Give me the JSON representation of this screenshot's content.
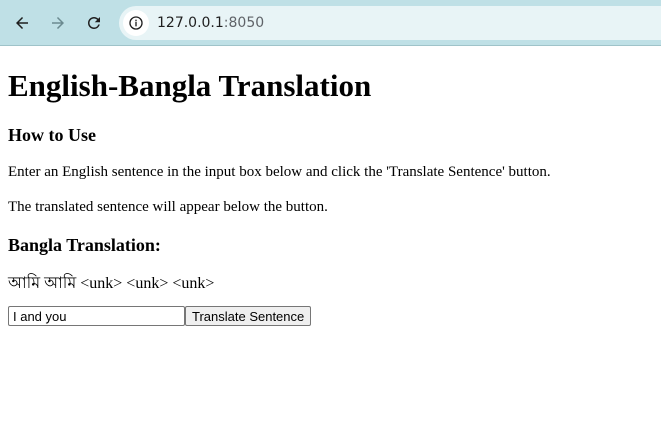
{
  "browser": {
    "url_host": "127.0.0.1",
    "url_port": ":8050",
    "icons": [
      "back-arrow-icon",
      "forward-arrow-icon",
      "reload-icon",
      "info-icon"
    ]
  },
  "page": {
    "title": "English-Bangla Translation",
    "how_to_title": "How to Use",
    "instruction_1": "Enter an English sentence in the input box below and click the 'Translate Sentence' button.",
    "instruction_2": "The translated sentence will appear below the button.",
    "translation_title": "Bangla Translation:",
    "translation_output": "আমি আমি <unk> <unk> <unk>",
    "input_value": "I and you",
    "button_label": "Translate Sentence"
  }
}
